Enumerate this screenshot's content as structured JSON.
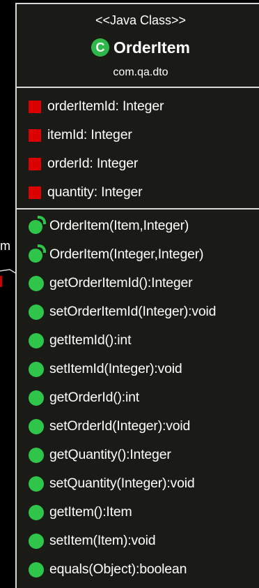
{
  "edge": {
    "label": "m"
  },
  "class": {
    "stereotype": "<<Java Class>>",
    "icon_letter": "C",
    "name": "OrderItem",
    "package": "com.qa.dto",
    "colors": {
      "background": "#1a1a17",
      "border": "#d9d9d9",
      "field_icon": "#dd0000",
      "method_icon": "#2fc44a",
      "class_icon": "#2fb84a"
    },
    "fields": [
      {
        "icon": "private-field-icon",
        "text": "orderItemId: Integer"
      },
      {
        "icon": "private-field-icon",
        "text": "itemId: Integer"
      },
      {
        "icon": "private-field-icon",
        "text": "orderId: Integer"
      },
      {
        "icon": "private-field-icon",
        "text": "quantity: Integer"
      }
    ],
    "methods": [
      {
        "icon": "constructor-icon",
        "text": "OrderItem(Item,Integer)"
      },
      {
        "icon": "constructor-icon",
        "text": "OrderItem(Integer,Integer)"
      },
      {
        "icon": "public-method-icon",
        "text": "getOrderItemId():Integer"
      },
      {
        "icon": "public-method-icon",
        "text": "setOrderItemId(Integer):void"
      },
      {
        "icon": "public-method-icon",
        "text": "getItemId():int"
      },
      {
        "icon": "public-method-icon",
        "text": "setItemId(Integer):void"
      },
      {
        "icon": "public-method-icon",
        "text": "getOrderId():int"
      },
      {
        "icon": "public-method-icon",
        "text": "setOrderId(Integer):void"
      },
      {
        "icon": "public-method-icon",
        "text": "getQuantity():Integer"
      },
      {
        "icon": "public-method-icon",
        "text": "setQuantity(Integer):void"
      },
      {
        "icon": "public-method-icon",
        "text": "getItem():Item"
      },
      {
        "icon": "public-method-icon",
        "text": "setItem(Item):void"
      },
      {
        "icon": "public-method-icon",
        "text": "equals(Object):boolean"
      }
    ]
  }
}
